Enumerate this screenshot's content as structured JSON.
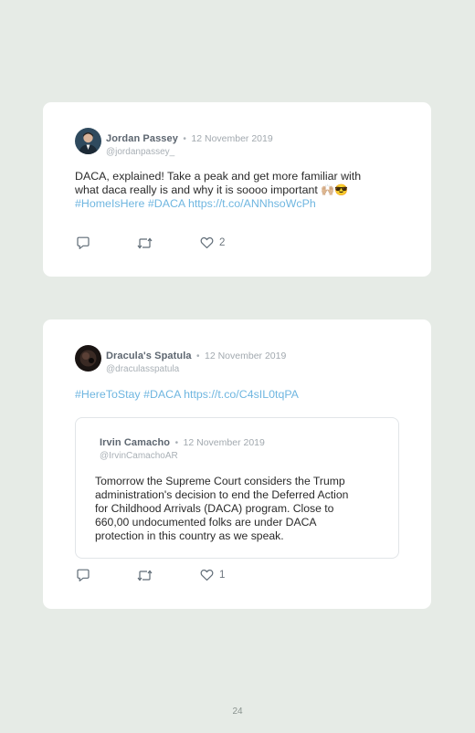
{
  "tweets": [
    {
      "author": "Jordan Passey",
      "separator": "•",
      "date": "12 November 2019",
      "handle": "@jordanpassey_",
      "text_line1": "DACA, explained! Take a peak and get more familiar with",
      "text_line2": "what daca really is and why it is soooo important ",
      "emoji": "🙌🏼😎",
      "hashtags": "#HomeIsHere #DACA https://t.co/ANNhsoWcPh",
      "like_count": "2"
    },
    {
      "author": "Dracula's Spatula",
      "separator": "•",
      "date": "12 November 2019",
      "handle": "@draculasspatula",
      "hashtags": "#HereToStay #DACA https://t.co/C4sIL0tqPA",
      "like_count": "1",
      "quoted": {
        "author": "Irvin Camacho",
        "separator": "•",
        "date": "12 November 2019",
        "handle": "@IrvinCamachoAR",
        "lines": [
          "Tomorrow the Supreme Court considers the Trump",
          "administration's decision to end the Deferred Action",
          "for Childhood Arrivals (DACA) program. Close to",
          "660,00 undocumented folks are under DACA",
          "protection in this country as we speak."
        ]
      }
    }
  ],
  "icons": [
    "reply-icon",
    "retweet-icon",
    "heart-icon"
  ],
  "colors": {
    "link": "#6fb6e0",
    "background": "#e6ebe6",
    "card": "#ffffff"
  },
  "page_number": "24"
}
